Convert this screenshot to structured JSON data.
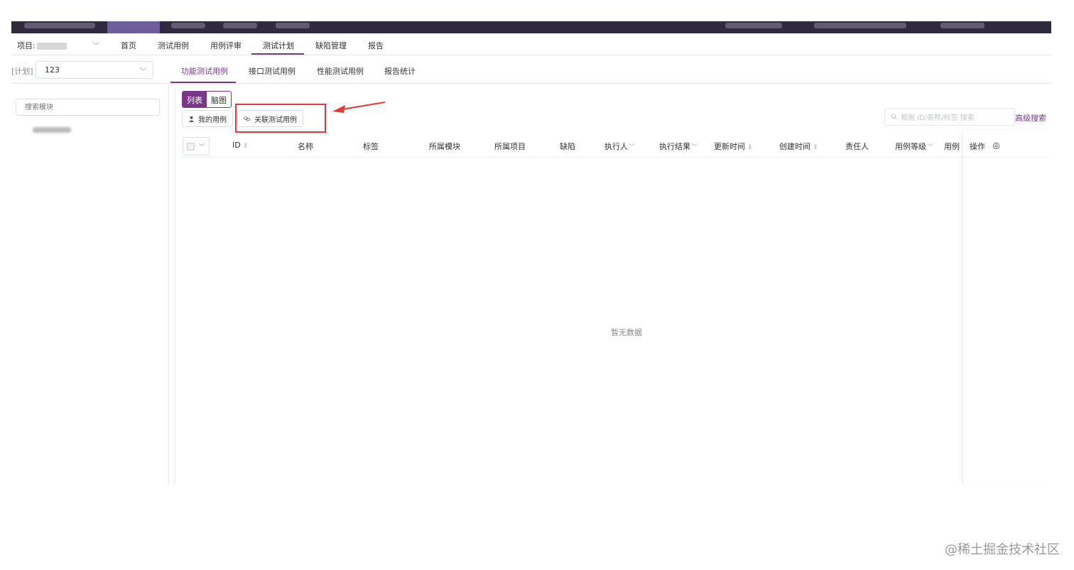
{
  "header": {
    "nav_items": [
      {
        "label": "首页"
      },
      {
        "label": "测试用例"
      },
      {
        "label": "用例评审"
      },
      {
        "label": "测试计划"
      },
      {
        "label": "缺陷管理"
      },
      {
        "label": "报告"
      }
    ],
    "active_nav": "测试计划",
    "project_label": "项目:"
  },
  "plan": {
    "label": "[计划]",
    "selected": "123",
    "tabs": [
      {
        "label": "功能测试用例"
      },
      {
        "label": "接口测试用例"
      },
      {
        "label": "性能测试用例"
      },
      {
        "label": "报告统计"
      }
    ],
    "active_tab": "功能测试用例"
  },
  "sidebar": {
    "search_placeholder": "搜索模块"
  },
  "toolbar": {
    "list_label": "列表",
    "mind_label": "脑图",
    "my_cases_label": "我的用例",
    "link_cases_label": "关联测试用例",
    "search_placeholder": "根据 ID/名称/标签 搜索",
    "advanced_search_label": "高级搜索"
  },
  "table": {
    "columns": [
      {
        "label": "ID"
      },
      {
        "label": "名称"
      },
      {
        "label": "标签"
      },
      {
        "label": "所属模块"
      },
      {
        "label": "所属项目"
      },
      {
        "label": "缺陷"
      },
      {
        "label": "执行人"
      },
      {
        "label": "执行结果"
      },
      {
        "label": "更新时间"
      },
      {
        "label": "创建时间"
      },
      {
        "label": "责任人"
      },
      {
        "label": "用例等级"
      },
      {
        "label": "用例"
      },
      {
        "label": "操作"
      }
    ],
    "empty_text": "暂无数据"
  },
  "watermark": "@稀土掘金技术社区",
  "colors": {
    "brand": "#783887",
    "highlight": "#e53935",
    "topbar": "#2f2a3e"
  }
}
